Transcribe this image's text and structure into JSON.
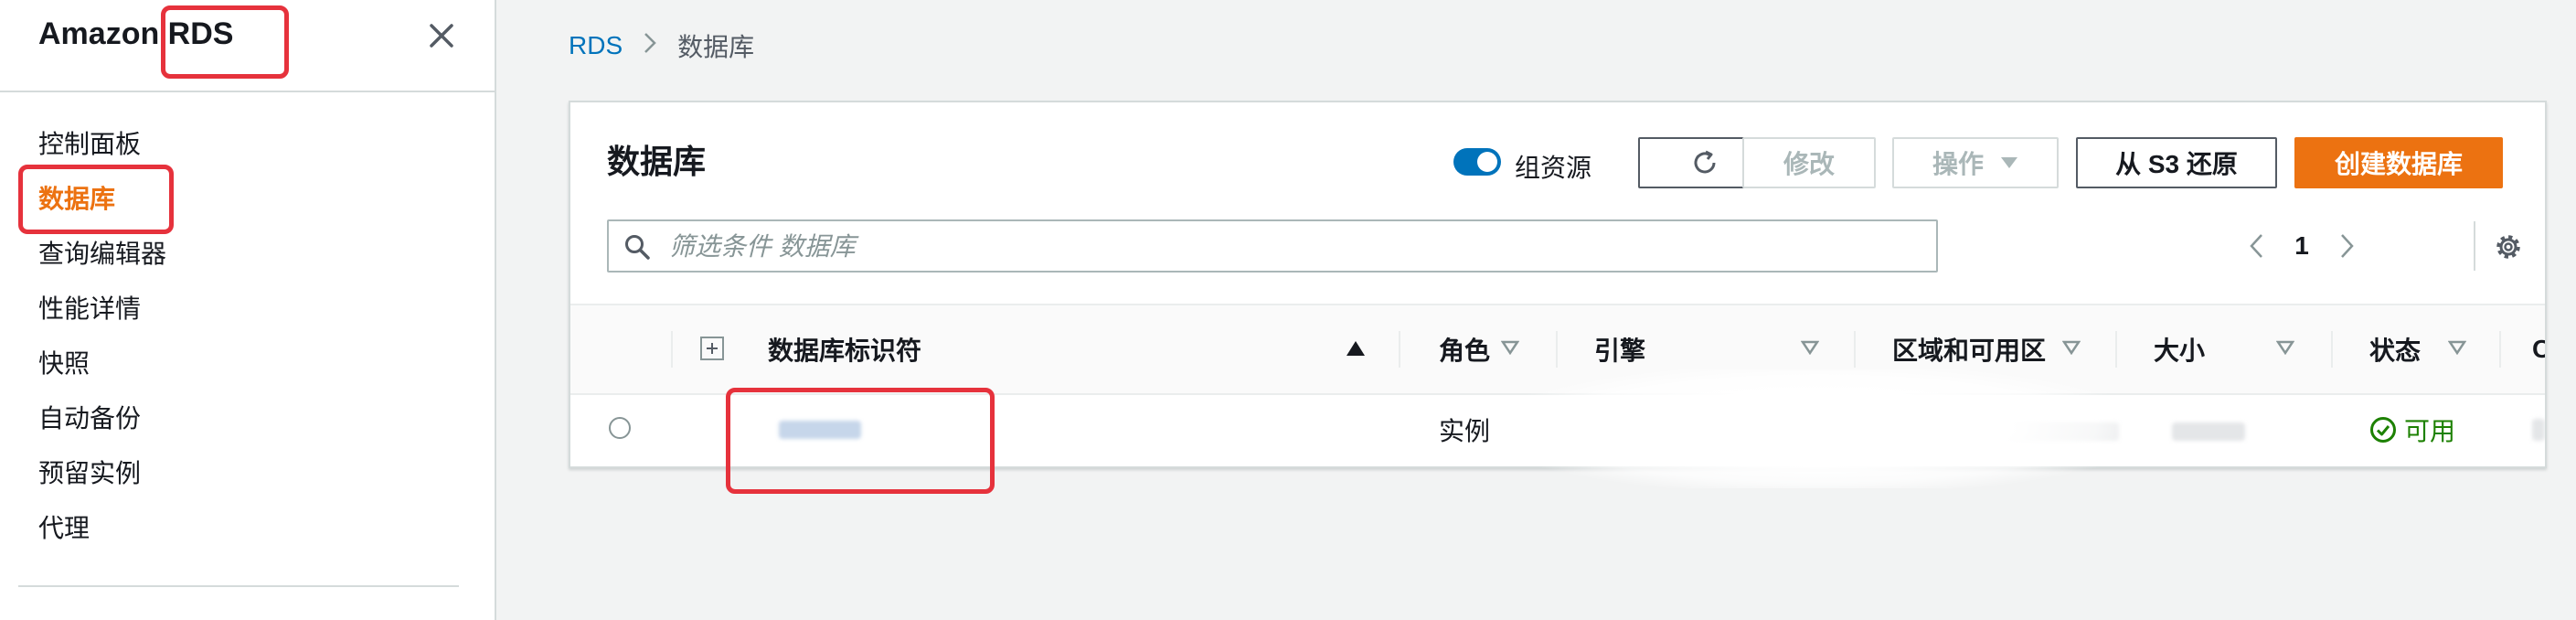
{
  "sidebar": {
    "title": "Amazon RDS",
    "items": [
      {
        "label": "控制面板"
      },
      {
        "label": "数据库"
      },
      {
        "label": "查询编辑器"
      },
      {
        "label": "性能详情"
      },
      {
        "label": "快照"
      },
      {
        "label": "自动备份"
      },
      {
        "label": "预留实例"
      },
      {
        "label": "代理"
      }
    ]
  },
  "breadcrumb": {
    "root": "RDS",
    "current": "数据库"
  },
  "panel": {
    "title": "数据库",
    "toggle_label": "组资源",
    "buttons": {
      "modify": "修改",
      "actions": "操作",
      "restore_s3": "从 S3 还原",
      "create": "创建数据库"
    },
    "search_placeholder": "筛选条件 数据库",
    "page": "1"
  },
  "table": {
    "columns": [
      "数据库标识符",
      "角色",
      "引擎",
      "区域和可用区",
      "大小",
      "状态",
      "C"
    ],
    "row": {
      "role": "实例",
      "status": "可用"
    }
  },
  "colors": {
    "accent": "#ec7211",
    "link": "#0073bb",
    "success": "#1d8102",
    "highlight": "#e6323c"
  }
}
